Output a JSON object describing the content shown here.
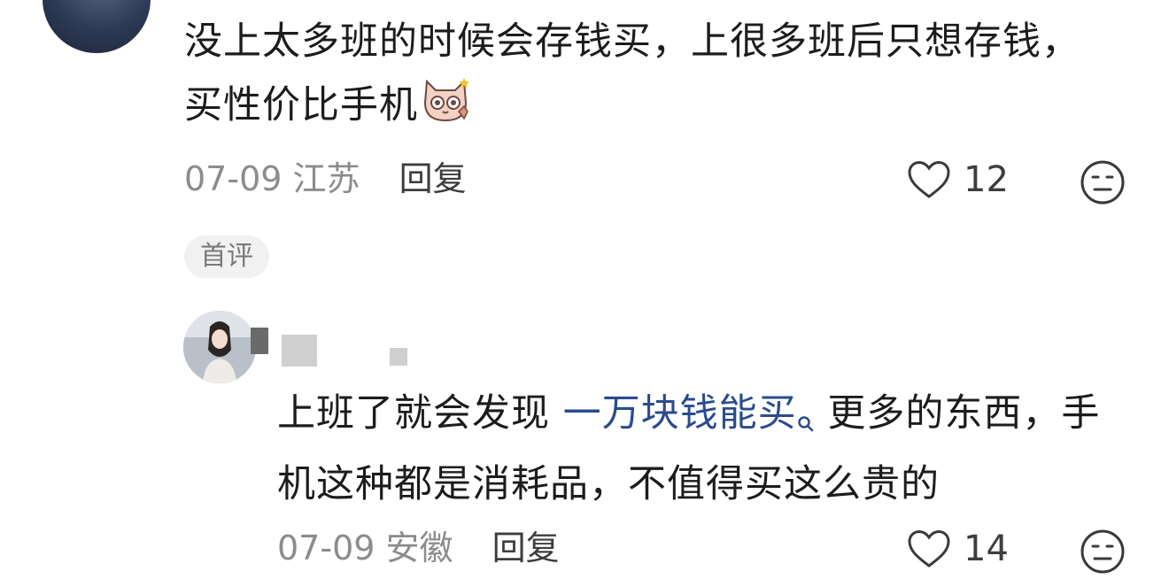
{
  "comments": [
    {
      "text": "没上太多班的时候会存钱买，上很多班后只想存钱，买性价比手机",
      "date": "07-09",
      "location": "江苏",
      "reply_label": "回复",
      "likes": "12",
      "icons": {
        "like": "heart-outline-icon",
        "dislike": "neutral-face-icon",
        "emoji": "cat-emoji-icon"
      }
    },
    {
      "badge": "首评",
      "text_before": "上班了就会发现 ",
      "keyword": "一万块钱能买",
      "text_after": " 更多的东西，手机这种都是消耗品，不值得买这么贵的",
      "date": "07-09",
      "location": "安徽",
      "reply_label": "回复",
      "likes": "14",
      "keyword_color": "#2a4b8d",
      "icons": {
        "keyword_search": "search-icon",
        "like": "heart-outline-icon",
        "dislike": "neutral-face-icon"
      }
    }
  ]
}
